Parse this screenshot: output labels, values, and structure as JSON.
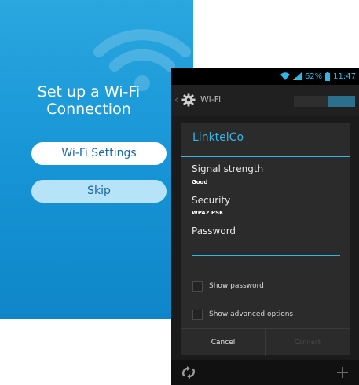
{
  "setup": {
    "title_line1": "Set up a Wi-Fi",
    "title_line2": "Connection",
    "wifi_settings_label": "Wi-Fi Settings",
    "skip_label": "Skip",
    "background_color": "#1795d6"
  },
  "status_bar": {
    "battery_percent": "62%",
    "time": "11:47"
  },
  "action_bar": {
    "title": "Wi-Fi",
    "switch_on": true
  },
  "dialog": {
    "network_name": "LinktelCo",
    "signal_strength_label": "Signal strength",
    "signal_strength_value": "Good",
    "security_label": "Security",
    "security_value": "WPA2 PSK",
    "password_label": "Password",
    "password_value": "",
    "show_password_label": "Show password",
    "show_password_checked": false,
    "show_advanced_label": "Show advanced options",
    "show_advanced_checked": false,
    "cancel_label": "Cancel",
    "connect_label": "Connect",
    "connect_enabled": false
  },
  "colors": {
    "accent": "#33b5e5",
    "dialog_bg": "#2b2b2b",
    "screen_bg": "#1b1b1b"
  },
  "icons": [
    "wifi-signal-icon",
    "cell-signal-icon",
    "battery-icon",
    "settings-gear-icon",
    "scan-icon",
    "add-network-icon"
  ]
}
